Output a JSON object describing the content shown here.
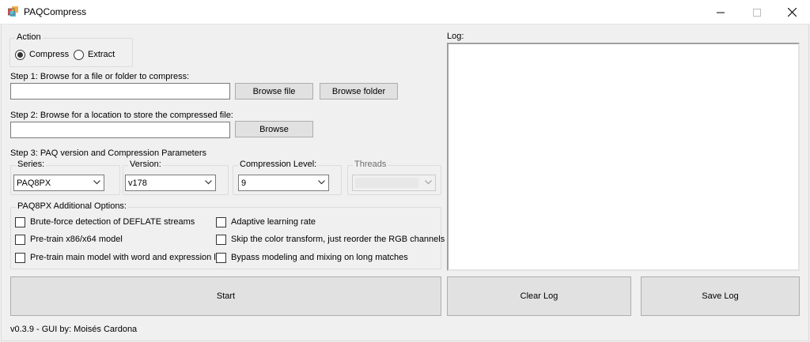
{
  "window": {
    "title": "PAQCompress",
    "controls": {
      "minimize_icon": "minimize-icon",
      "maximize_icon": "maximize-icon",
      "close_icon": "close-icon"
    }
  },
  "action": {
    "legend": "Action",
    "options": [
      {
        "label": "Compress",
        "selected": true
      },
      {
        "label": "Extract",
        "selected": false
      }
    ]
  },
  "step1": {
    "label": "Step 1: Browse for a file or folder to compress:",
    "input_value": "",
    "browse_file": "Browse file",
    "browse_folder": "Browse folder"
  },
  "step2": {
    "label": "Step 2: Browse for a location to store the compressed file:",
    "input_value": "",
    "browse": "Browse"
  },
  "step3": {
    "label": "Step 3: PAQ version and Compression Parameters",
    "series": {
      "legend": "Series:",
      "value": "PAQ8PX"
    },
    "version": {
      "legend": "Version:",
      "value": "v178"
    },
    "level": {
      "legend": "Compression Level:",
      "value": "9"
    },
    "threads": {
      "legend": "Threads",
      "value": "",
      "enabled": false
    }
  },
  "options": {
    "legend": "PAQ8PX Additional Options:",
    "items": [
      {
        "label": "Brute-force detection of DEFLATE streams",
        "checked": false
      },
      {
        "label": "Pre-train x86/x64 model",
        "checked": false
      },
      {
        "label": "Pre-train main model with word and expression list",
        "checked": false
      },
      {
        "label": "Adaptive learning rate",
        "checked": false
      },
      {
        "label": "Skip the color transform, just reorder the RGB channels",
        "checked": false
      },
      {
        "label": "Bypass modeling and mixing on long matches",
        "checked": false
      }
    ]
  },
  "log": {
    "label": "Log:",
    "content": ""
  },
  "buttons": {
    "start": "Start",
    "clear_log": "Clear Log",
    "save_log": "Save Log"
  },
  "footer": {
    "version_text": "v0.3.9 - GUI by: Moisés Cardona"
  },
  "colors": {
    "window_bg": "#f0f0f0",
    "button_bg": "#e1e1e1",
    "button_border": "#adadad",
    "groupbox_border": "#dcdcdc"
  }
}
